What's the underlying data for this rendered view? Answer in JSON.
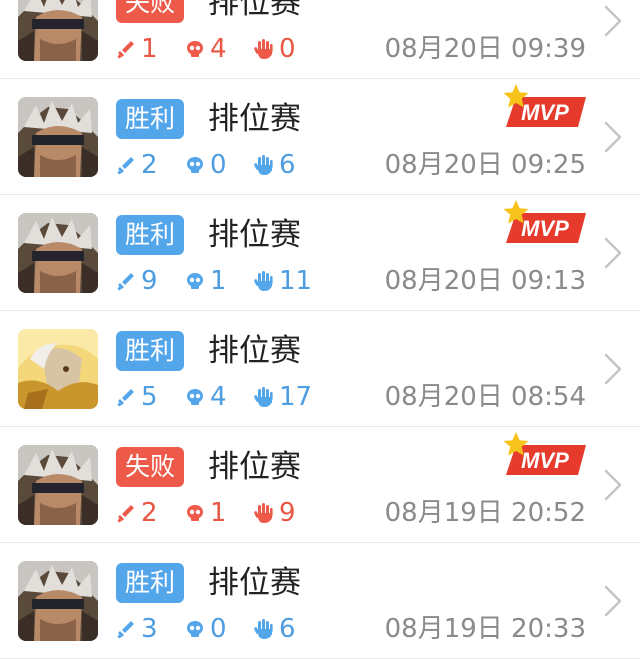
{
  "mvp_label": "MVP",
  "colors": {
    "win": "#54a6ea",
    "loss": "#ee5a4a",
    "time": "#8a8a8a",
    "mvp": "#e53a2c",
    "star": "#f7c21a"
  },
  "icons": {
    "kills": "kill-sword-icon",
    "deaths": "death-skull-icon",
    "assists": "assist-hand-icon",
    "chevron": "chevron-right-icon",
    "mvp_star": "mvp-star-icon"
  },
  "matches": [
    {
      "result": "失败",
      "outcome": "loss",
      "mode": "排位赛",
      "kills": "1",
      "deaths": "4",
      "assists": "0",
      "time": "08月20日 09:39",
      "mvp": false,
      "hero": "dark-warrior"
    },
    {
      "result": "胜利",
      "outcome": "win",
      "mode": "排位赛",
      "kills": "2",
      "deaths": "0",
      "assists": "6",
      "time": "08月20日 09:25",
      "mvp": true,
      "hero": "dark-warrior"
    },
    {
      "result": "胜利",
      "outcome": "win",
      "mode": "排位赛",
      "kills": "9",
      "deaths": "1",
      "assists": "11",
      "time": "08月20日 09:13",
      "mvp": true,
      "hero": "dark-warrior"
    },
    {
      "result": "胜利",
      "outcome": "win",
      "mode": "排位赛",
      "kills": "5",
      "deaths": "4",
      "assists": "17",
      "time": "08月20日 08:54",
      "mvp": false,
      "hero": "golden-warrior"
    },
    {
      "result": "失败",
      "outcome": "loss",
      "mode": "排位赛",
      "kills": "2",
      "deaths": "1",
      "assists": "9",
      "time": "08月19日 20:52",
      "mvp": true,
      "hero": "dark-warrior"
    },
    {
      "result": "胜利",
      "outcome": "win",
      "mode": "排位赛",
      "kills": "3",
      "deaths": "0",
      "assists": "6",
      "time": "08月19日 20:33",
      "mvp": false,
      "hero": "dark-warrior"
    }
  ]
}
